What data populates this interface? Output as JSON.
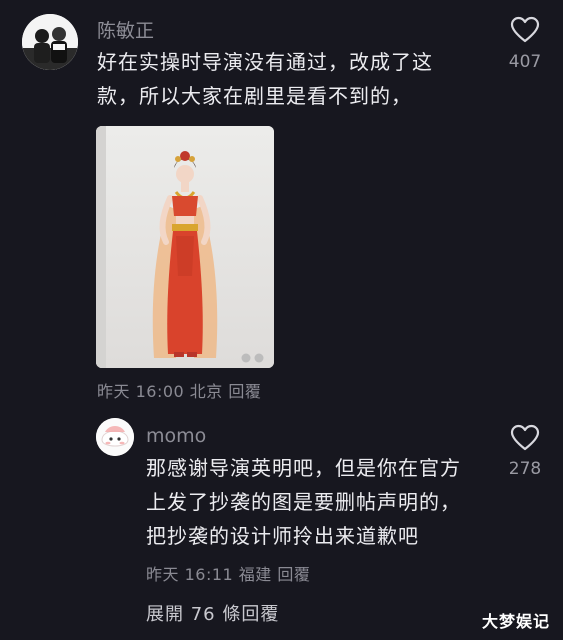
{
  "comment": {
    "username": "陈敏正",
    "text_lines": [
      "好在实操时导演没有通过，改成了这",
      "款，所以大家在剧里是看不到的，"
    ],
    "like_count": "407",
    "meta": {
      "time": "昨天 16:00",
      "location": "北京",
      "reply_label": "回覆"
    }
  },
  "reply": {
    "username": "momo",
    "text_lines": [
      "那感谢导演英明吧，但是你在官方",
      "上发了抄袭的图是要删帖声明的，",
      "把抄袭的设计师拎出来道歉吧"
    ],
    "like_count": "278",
    "meta": {
      "time": "昨天 16:11",
      "location": "福建",
      "reply_label": "回覆"
    }
  },
  "expand_replies": "展開 76 條回覆",
  "watermark": "大梦娱记",
  "icons": {
    "like": "heart-outline-icon",
    "image_more": "more-dots-icon"
  },
  "colors": {
    "background": "#17171f",
    "dress": "#d9432c"
  }
}
